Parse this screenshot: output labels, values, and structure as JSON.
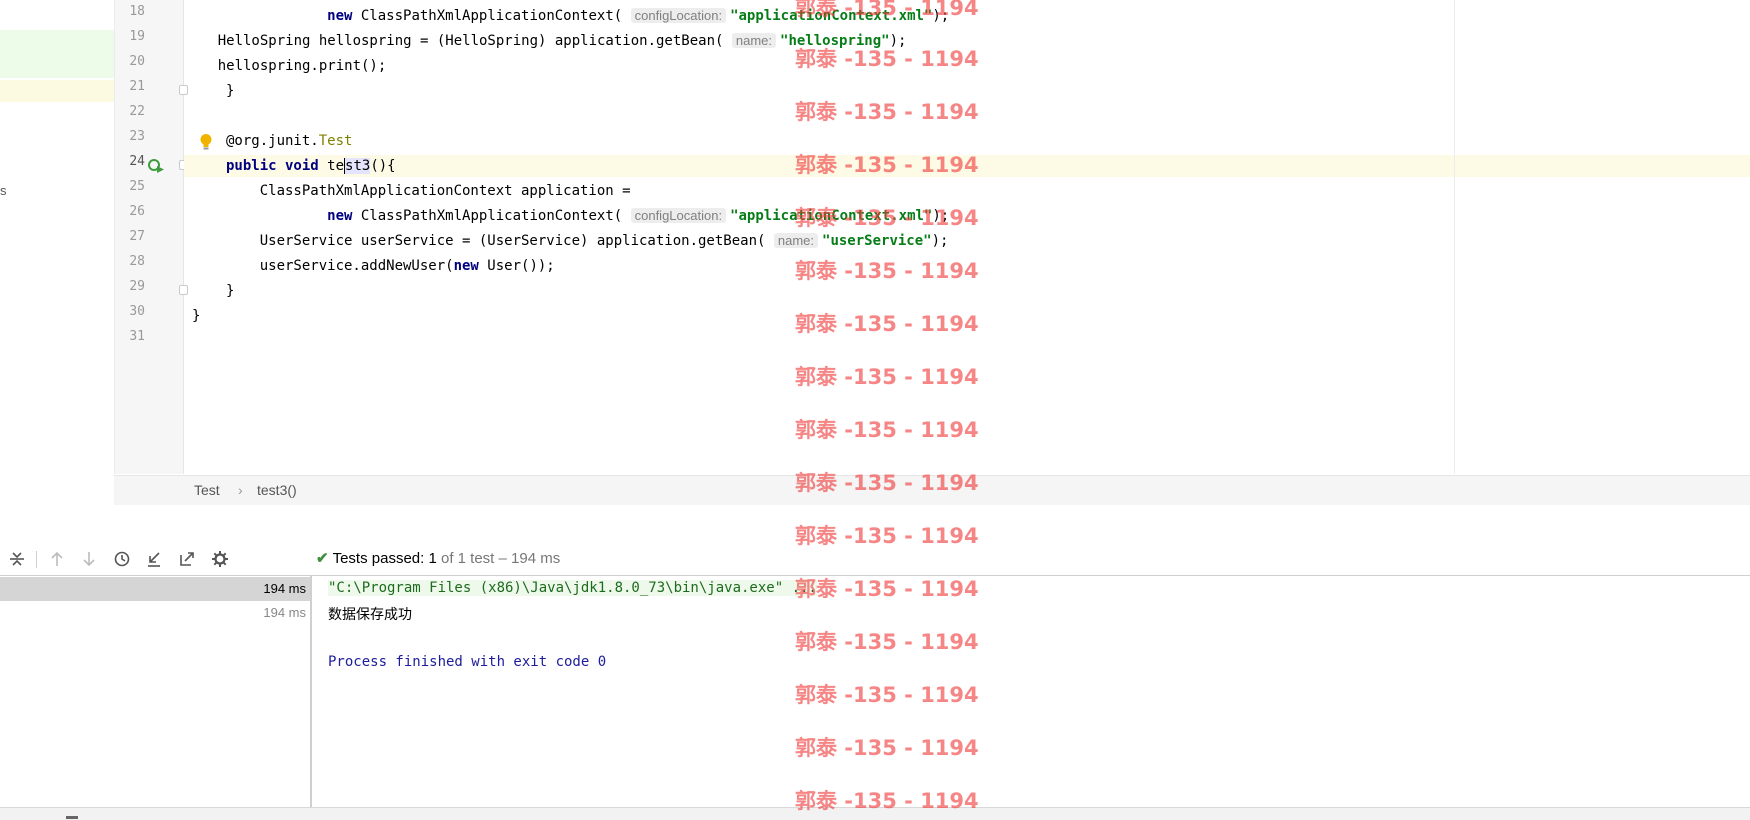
{
  "editor": {
    "line_numbers": [
      "18",
      "19",
      "20",
      "21",
      "22",
      "23",
      "24",
      "25",
      "26",
      "27",
      "28",
      "29",
      "30",
      "31"
    ],
    "lines": {
      "l18_indent": "            ",
      "l18_new": "new",
      "l18_a": " ClassPathXmlApplicationContext(",
      "l18_hint": "configLocation:",
      "l18_str": "\"applicationContext.xml\"",
      "l18_end": ");",
      "l19_a": "    HelloSpring hellospring = (HelloSpring) application.getBean(",
      "l19_hint": "name:",
      "l19_str": "\"hellospring\"",
      "l19_end": ");",
      "l20": "    hellospring.print();",
      "l21": "}",
      "l23_at": "@org.junit.",
      "l23_anno": "Test",
      "l24_kw": "public void",
      "l24_pre": " te",
      "l24_post": "st3",
      "l24_end": "(){",
      "l25": "    ClassPathXmlApplicationContext application =",
      "l26_indent": "            ",
      "l26_new": "new",
      "l26_a": " ClassPathXmlApplicationContext(",
      "l26_hint": "configLocation:",
      "l26_str": "\"applicationContext.xml\"",
      "l26_end": ");",
      "l27_a": "    UserService userService = (UserService) application.getBean(",
      "l27_hint": "name:",
      "l27_str": "\"userService\"",
      "l27_end": ");",
      "l28_a": "    userService.addNewUser(",
      "l28_new": "new",
      "l28_end": " User());",
      "l29": "}",
      "l30": "}"
    }
  },
  "breadcrumb": {
    "class_name": "Test",
    "separator": "›",
    "method_name": "test3()"
  },
  "run": {
    "status_label": "Tests passed:",
    "status_count": "1",
    "status_rest": "of 1 test – 194 ms",
    "tree": [
      {
        "duration": "194 ms"
      },
      {
        "duration": "194 ms"
      }
    ],
    "console": {
      "command": "\"C:\\Program Files (x86)\\Java\\jdk1.8.0_73\\bin\\java.exe\" ...",
      "output": "数据保存成功",
      "exit": "Process finished with exit code 0"
    }
  },
  "watermark": "郭泰 -135 - 1194",
  "icons": [
    "lightbulb-icon",
    "run-test-icon",
    "collapse-icon",
    "arrow-up-icon",
    "arrow-down-icon",
    "history-icon",
    "import-tests-icon",
    "export-tests-icon",
    "settings-icon",
    "check-icon"
  ]
}
